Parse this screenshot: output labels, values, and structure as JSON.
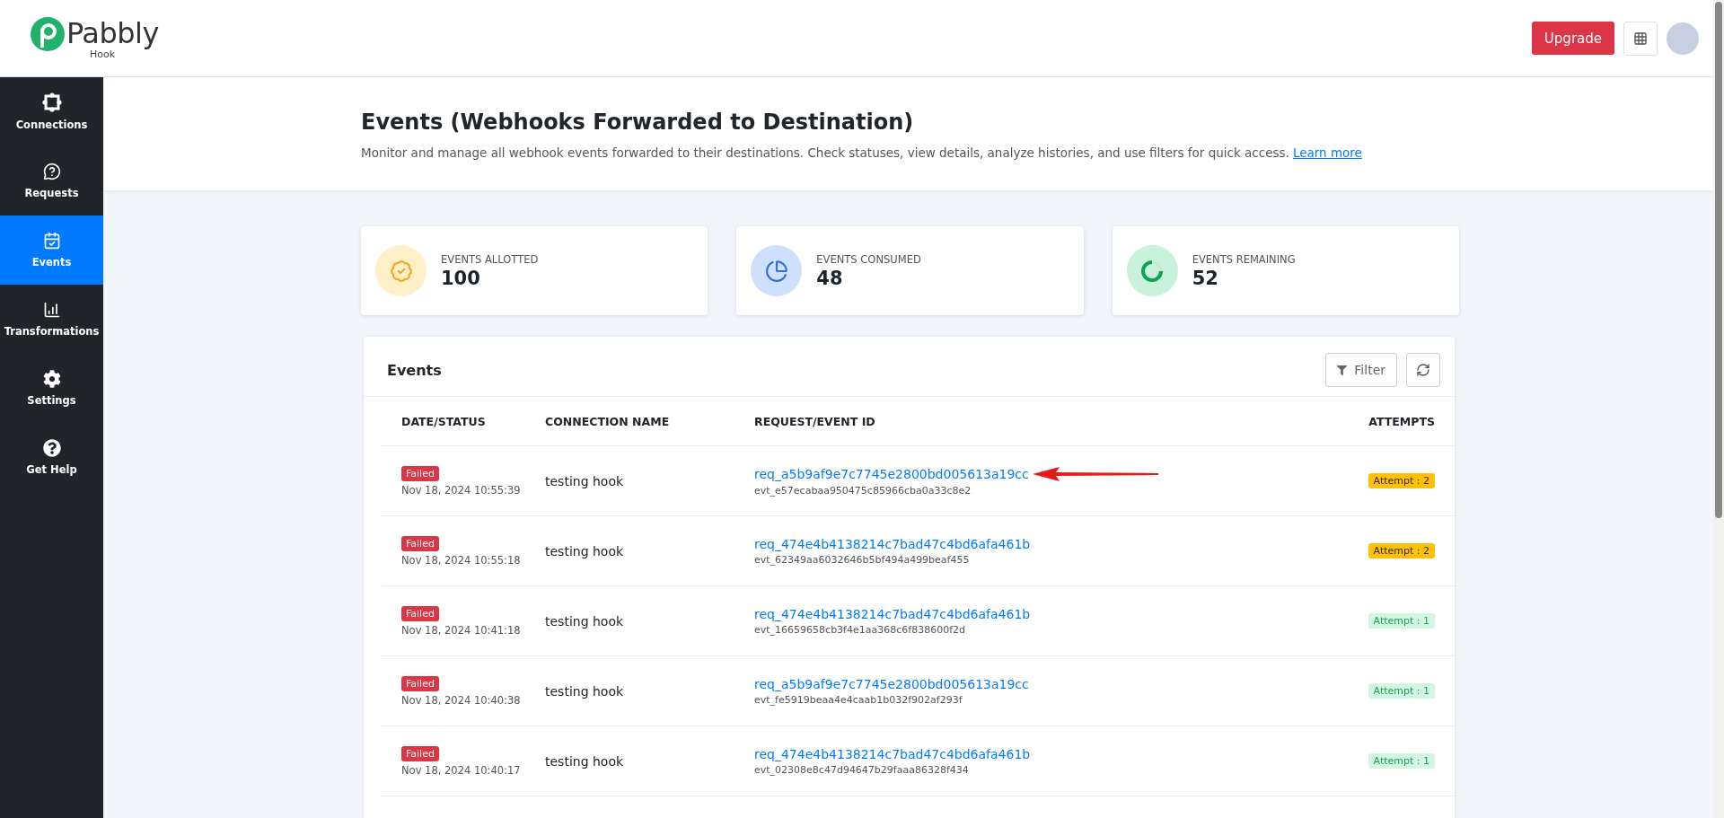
{
  "logo": {
    "name": "Pabbly",
    "product": "Hook"
  },
  "header": {
    "upgrade_button": "Upgrade"
  },
  "sidebar": {
    "items": [
      {
        "label": "Connections",
        "kind": "connections",
        "selected": false
      },
      {
        "label": "Requests",
        "kind": "requests",
        "selected": false
      },
      {
        "label": "Events",
        "kind": "events",
        "selected": true
      },
      {
        "label": "Transformations",
        "kind": "transformations",
        "selected": false
      },
      {
        "label": "Settings",
        "kind": "settings",
        "selected": false
      },
      {
        "label": "Get Help",
        "kind": "help",
        "selected": false
      }
    ]
  },
  "page": {
    "title": "Events (Webhooks Forwarded to Destination)",
    "description": "Monitor and manage all webhook events forwarded to their destinations. Check statuses, view details, analyze histories, and use filters for quick access.",
    "link": "Learn more"
  },
  "stats": [
    {
      "label": "EVENTS ALLOTTED",
      "value": "100",
      "kind": "allotted"
    },
    {
      "label": "EVENTS CONSUMED",
      "value": "48",
      "kind": "consumed"
    },
    {
      "label": "EVENTS REMAINING",
      "value": "52",
      "kind": "remaining"
    }
  ],
  "table": {
    "title": "Events",
    "filter_button": "Filter",
    "columns": [
      "DATE/STATUS",
      "CONNECTION NAME",
      "REQUEST/EVENT ID",
      "ATTEMPTS"
    ],
    "rows": [
      {
        "status": "Failed",
        "date": "Nov 18, 2024 10:55:39",
        "connection": "testing hook",
        "request_id": "req_a5b9af9e7c7745e2800bd005613a19cc",
        "event_id": "evt_e57ecabaa950475c85966cba0a33c8e2",
        "attempt": "Attempt : 2",
        "color": "#ffc107",
        "pointer_arrow": true
      },
      {
        "status": "Failed",
        "date": "Nov 18, 2024 10:55:18",
        "connection": "testing hook",
        "request_id": "req_474e4b4138214c7bad47c4bd6afa461b",
        "event_id": "evt_62349aa6032646b5bf494a499beaf455",
        "attempt": "Attempt : 2",
        "color": "#ffc107",
        "pointer_arrow": false
      },
      {
        "status": "Failed",
        "date": "Nov 18, 2024 10:41:18",
        "connection": "testing hook",
        "request_id": "req_474e4b4138214c7bad47c4bd6afa461b",
        "event_id": "evt_16659658cb3f4e1aa368c6f838600f2d",
        "attempt": "Attempt : 1",
        "color": "#d1f7e3",
        "pointer_arrow": false
      },
      {
        "status": "Failed",
        "date": "Nov 18, 2024 10:40:38",
        "connection": "testing hook",
        "request_id": "req_a5b9af9e7c7745e2800bd005613a19cc",
        "event_id": "evt_fe5919beaa4e4caab1b032f902af293f",
        "attempt": "Attempt : 1",
        "color": "#d1f7e3",
        "pointer_arrow": false
      },
      {
        "status": "Failed",
        "date": "Nov 18, 2024 10:40:17",
        "connection": "testing hook",
        "request_id": "req_474e4b4138214c7bad47c4bd6afa461b",
        "event_id": "evt_02308e8c47d94647b29faaa86328f434",
        "attempt": "Attempt : 1",
        "color": "#d1f7e3",
        "pointer_arrow": false
      }
    ]
  }
}
